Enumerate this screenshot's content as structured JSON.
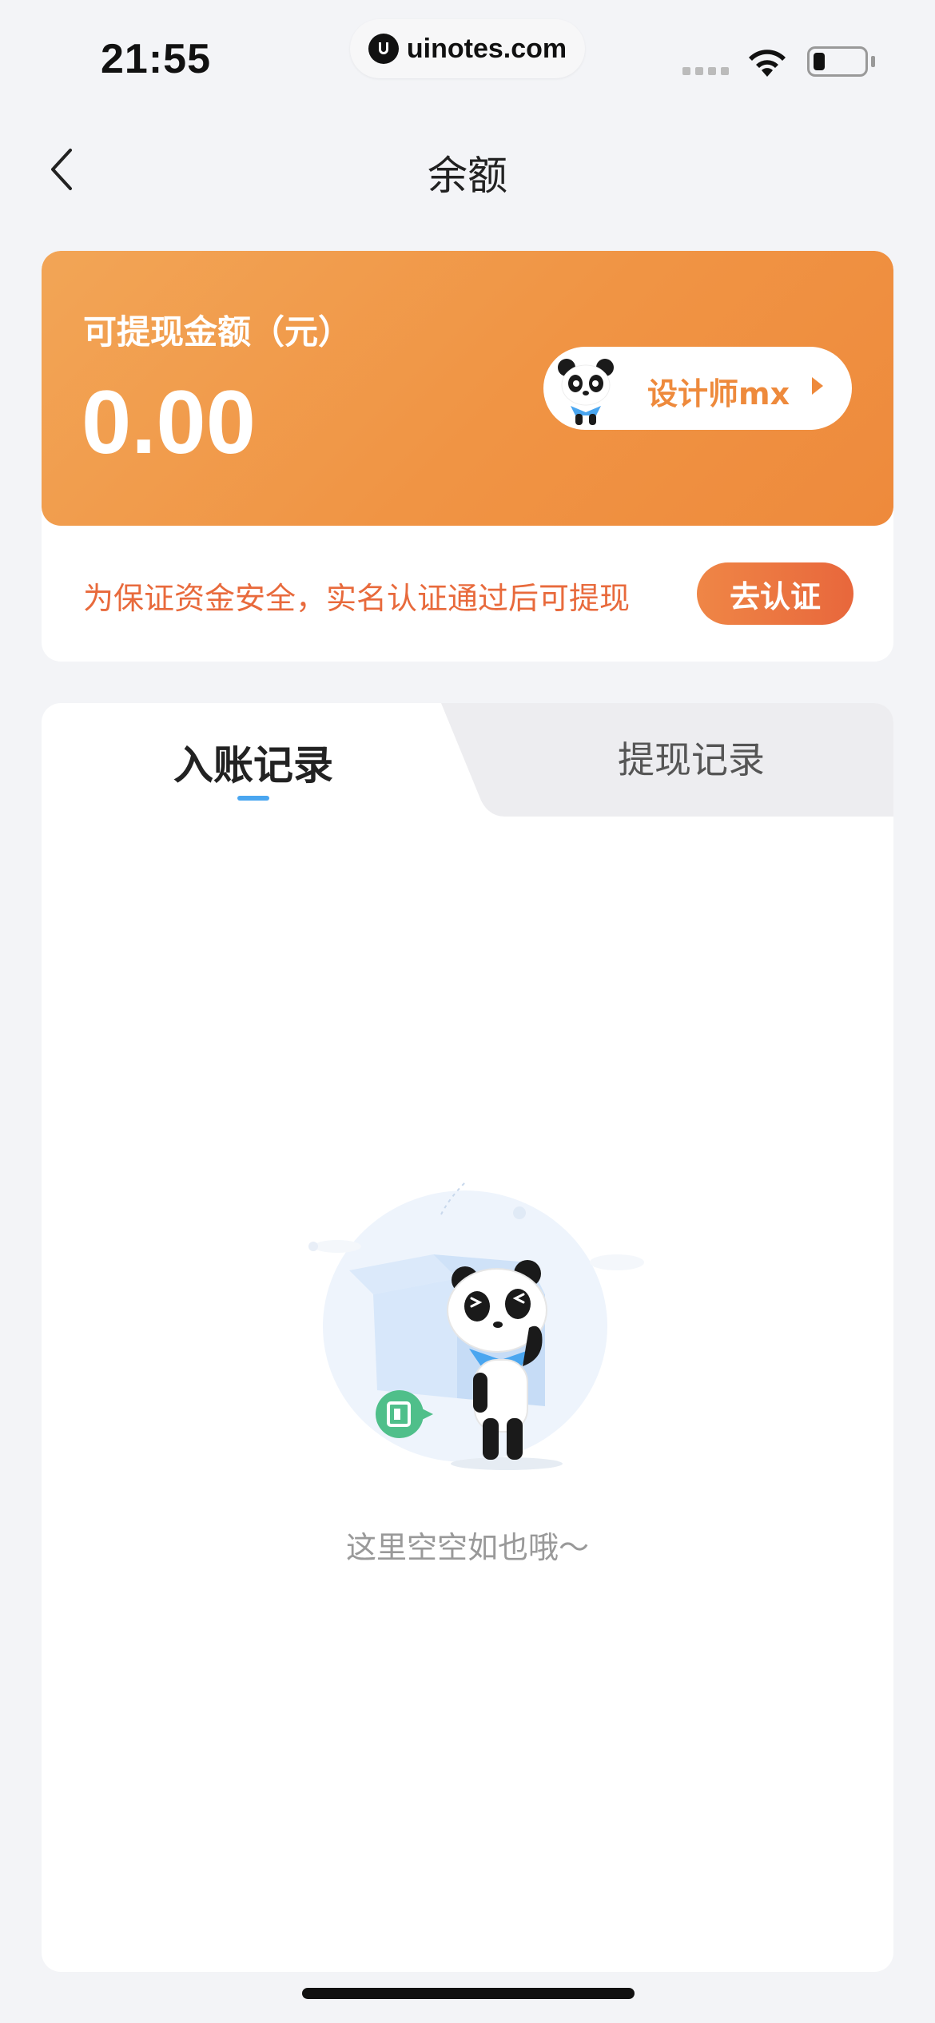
{
  "status_bar": {
    "time": "21:55",
    "url": "uinotes.com"
  },
  "nav": {
    "title": "余额",
    "back_icon": "chevron-left-icon"
  },
  "balance": {
    "label": "可提现金额（元）",
    "amount": "0.00",
    "user_name": "设计师mx",
    "verify_notice": "为保证资金安全，实名认证通过后可提现",
    "verify_button": "去认证"
  },
  "records": {
    "tabs": [
      {
        "label": "入账记录",
        "active": true
      },
      {
        "label": "提现记录",
        "active": false
      }
    ],
    "empty_text": "这里空空如也哦～"
  },
  "colors": {
    "accent_orange": "#ee8a3c",
    "verify_red": "#e86a3c",
    "tab_indicator": "#4aa6f0",
    "background": "#f3f4f7"
  }
}
